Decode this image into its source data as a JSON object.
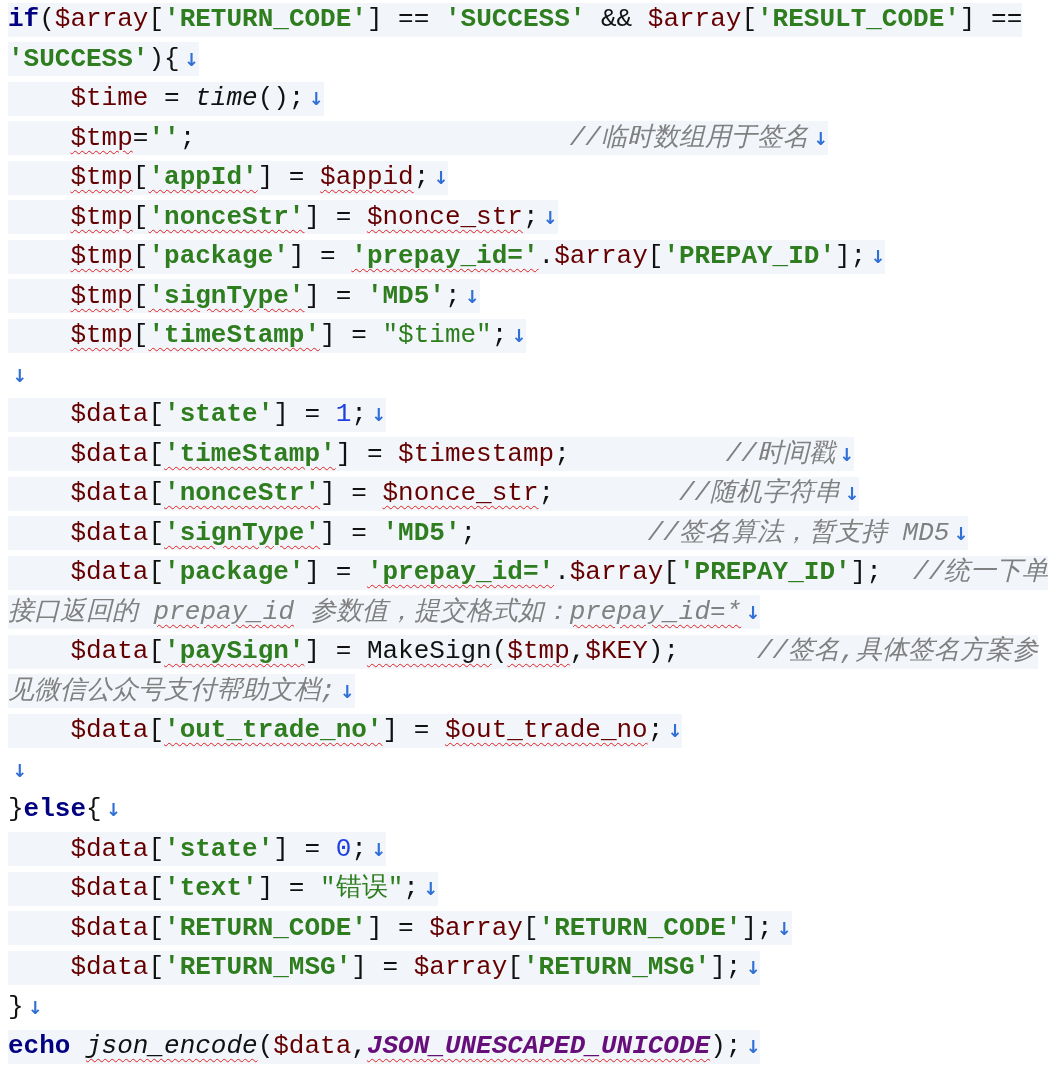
{
  "lines": [
    {
      "indented": false,
      "highlighted": true,
      "tokens": [
        {
          "kind": "keyword",
          "text": "if",
          "misspelled": false
        },
        {
          "kind": "plain",
          "text": "(",
          "misspelled": false
        },
        {
          "kind": "variable",
          "text": "$array",
          "misspelled": false
        },
        {
          "kind": "plain",
          "text": "[",
          "misspelled": false
        },
        {
          "kind": "string",
          "text": "'RETURN_CODE'",
          "misspelled": false
        },
        {
          "kind": "plain",
          "text": "] == ",
          "misspelled": false
        },
        {
          "kind": "string",
          "text": "'SUCCESS'",
          "misspelled": false
        },
        {
          "kind": "plain",
          "text": " && ",
          "misspelled": false
        },
        {
          "kind": "variable",
          "text": "$array",
          "misspelled": false
        },
        {
          "kind": "plain",
          "text": "[",
          "misspelled": false
        },
        {
          "kind": "string",
          "text": "'RESULT_CODE'",
          "misspelled": false
        },
        {
          "kind": "plain",
          "text": "] ==",
          "misspelled": false
        }
      ]
    },
    {
      "indented": false,
      "highlighted": true,
      "end_mark": "↓",
      "tokens": [
        {
          "kind": "string",
          "text": "'SUCCESS'",
          "misspelled": false
        },
        {
          "kind": "plain",
          "text": "){",
          "misspelled": false
        }
      ]
    },
    {
      "indented": true,
      "highlighted": true,
      "end_mark": "↓",
      "tokens": [
        {
          "kind": "variable",
          "text": "$time",
          "misspelled": false
        },
        {
          "kind": "plain",
          "text": " = ",
          "misspelled": false
        },
        {
          "kind": "function",
          "text": "time",
          "misspelled": false
        },
        {
          "kind": "plain",
          "text": "();",
          "misspelled": false
        }
      ]
    },
    {
      "indented": true,
      "highlighted": true,
      "end_mark": "↓",
      "tokens": [
        {
          "kind": "variable",
          "text": "$tmp",
          "misspelled": true
        },
        {
          "kind": "plain",
          "text": "=",
          "misspelled": false
        },
        {
          "kind": "string",
          "text": "''",
          "misspelled": false
        },
        {
          "kind": "plain",
          "text": ";                        ",
          "misspelled": false
        },
        {
          "kind": "comment",
          "text": "//临时数组用于签名",
          "misspelled": false
        }
      ]
    },
    {
      "indented": true,
      "highlighted": true,
      "end_mark": "↓",
      "tokens": [
        {
          "kind": "variable",
          "text": "$tmp",
          "misspelled": true
        },
        {
          "kind": "plain",
          "text": "[",
          "misspelled": false
        },
        {
          "kind": "string",
          "text": "'appId'",
          "misspelled": true
        },
        {
          "kind": "plain",
          "text": "] = ",
          "misspelled": false
        },
        {
          "kind": "variable",
          "text": "$appid",
          "misspelled": true
        },
        {
          "kind": "plain",
          "text": ";",
          "misspelled": false
        }
      ]
    },
    {
      "indented": true,
      "highlighted": true,
      "end_mark": "↓",
      "tokens": [
        {
          "kind": "variable",
          "text": "$tmp",
          "misspelled": true
        },
        {
          "kind": "plain",
          "text": "[",
          "misspelled": false
        },
        {
          "kind": "string",
          "text": "'nonceStr'",
          "misspelled": true
        },
        {
          "kind": "plain",
          "text": "] = ",
          "misspelled": false
        },
        {
          "kind": "variable",
          "text": "$nonce_str",
          "misspelled": true
        },
        {
          "kind": "plain",
          "text": ";",
          "misspelled": false
        }
      ]
    },
    {
      "indented": true,
      "highlighted": true,
      "end_mark": "↓",
      "tokens": [
        {
          "kind": "variable",
          "text": "$tmp",
          "misspelled": true
        },
        {
          "kind": "plain",
          "text": "[",
          "misspelled": false
        },
        {
          "kind": "string",
          "text": "'package'",
          "misspelled": false
        },
        {
          "kind": "plain",
          "text": "] = ",
          "misspelled": false
        },
        {
          "kind": "string",
          "text": "'prepay_id='",
          "misspelled": true
        },
        {
          "kind": "plain",
          "text": ".",
          "misspelled": false
        },
        {
          "kind": "variable",
          "text": "$array",
          "misspelled": false
        },
        {
          "kind": "plain",
          "text": "[",
          "misspelled": false
        },
        {
          "kind": "string",
          "text": "'PREPAY_ID'",
          "misspelled": false
        },
        {
          "kind": "plain",
          "text": "];",
          "misspelled": false
        }
      ]
    },
    {
      "indented": true,
      "highlighted": true,
      "end_mark": "↓",
      "tokens": [
        {
          "kind": "variable",
          "text": "$tmp",
          "misspelled": true
        },
        {
          "kind": "plain",
          "text": "[",
          "misspelled": false
        },
        {
          "kind": "string",
          "text": "'signType'",
          "misspelled": true
        },
        {
          "kind": "plain",
          "text": "] = ",
          "misspelled": false
        },
        {
          "kind": "string",
          "text": "'MD5'",
          "misspelled": false
        },
        {
          "kind": "plain",
          "text": ";",
          "misspelled": false
        }
      ]
    },
    {
      "indented": true,
      "highlighted": true,
      "end_mark": "↓",
      "tokens": [
        {
          "kind": "variable",
          "text": "$tmp",
          "misspelled": true
        },
        {
          "kind": "plain",
          "text": "[",
          "misspelled": false
        },
        {
          "kind": "string",
          "text": "'timeStamp'",
          "misspelled": true
        },
        {
          "kind": "plain",
          "text": "] = ",
          "misspelled": false
        },
        {
          "kind": "quoted",
          "text": "\"$time\"",
          "misspelled": false
        },
        {
          "kind": "plain",
          "text": ";",
          "misspelled": false
        }
      ]
    },
    {
      "indented": false,
      "highlighted": false,
      "end_mark": "↓"
    },
    {
      "indented": true,
      "highlighted": true,
      "end_mark": "↓",
      "tokens": [
        {
          "kind": "variable",
          "text": "$data",
          "misspelled": false
        },
        {
          "kind": "plain",
          "text": "[",
          "misspelled": false
        },
        {
          "kind": "string",
          "text": "'state'",
          "misspelled": false
        },
        {
          "kind": "plain",
          "text": "] = ",
          "misspelled": false
        },
        {
          "kind": "number",
          "text": "1",
          "misspelled": false
        },
        {
          "kind": "plain",
          "text": ";",
          "misspelled": false
        }
      ]
    },
    {
      "indented": true,
      "highlighted": true,
      "end_mark": "↓",
      "tokens": [
        {
          "kind": "variable",
          "text": "$data",
          "misspelled": false
        },
        {
          "kind": "plain",
          "text": "[",
          "misspelled": false
        },
        {
          "kind": "string",
          "text": "'timeStamp'",
          "misspelled": true
        },
        {
          "kind": "plain",
          "text": "] = ",
          "misspelled": false
        },
        {
          "kind": "variable",
          "text": "$timestamp",
          "misspelled": false
        },
        {
          "kind": "plain",
          "text": ";          ",
          "misspelled": false
        },
        {
          "kind": "comment",
          "text": "//时间戳",
          "misspelled": false
        }
      ]
    },
    {
      "indented": true,
      "highlighted": true,
      "end_mark": "↓",
      "tokens": [
        {
          "kind": "variable",
          "text": "$data",
          "misspelled": false
        },
        {
          "kind": "plain",
          "text": "[",
          "misspelled": false
        },
        {
          "kind": "string",
          "text": "'nonceStr'",
          "misspelled": true
        },
        {
          "kind": "plain",
          "text": "] = ",
          "misspelled": false
        },
        {
          "kind": "variable",
          "text": "$nonce_str",
          "misspelled": true
        },
        {
          "kind": "plain",
          "text": ";        ",
          "misspelled": false
        },
        {
          "kind": "comment",
          "text": "//随机字符串",
          "misspelled": false
        }
      ]
    },
    {
      "indented": true,
      "highlighted": true,
      "end_mark": "↓",
      "tokens": [
        {
          "kind": "variable",
          "text": "$data",
          "misspelled": false
        },
        {
          "kind": "plain",
          "text": "[",
          "misspelled": false
        },
        {
          "kind": "string",
          "text": "'signType'",
          "misspelled": true
        },
        {
          "kind": "plain",
          "text": "] = ",
          "misspelled": false
        },
        {
          "kind": "string",
          "text": "'MD5'",
          "misspelled": false
        },
        {
          "kind": "plain",
          "text": ";           ",
          "misspelled": false
        },
        {
          "kind": "comment",
          "text": "//签名算法，暂支持 MD5",
          "misspelled": false
        }
      ]
    },
    {
      "indented": true,
      "highlighted": true,
      "tokens": [
        {
          "kind": "variable",
          "text": "$data",
          "misspelled": false
        },
        {
          "kind": "plain",
          "text": "[",
          "misspelled": false
        },
        {
          "kind": "string",
          "text": "'package'",
          "misspelled": false
        },
        {
          "kind": "plain",
          "text": "] = ",
          "misspelled": false
        },
        {
          "kind": "string",
          "text": "'prepay_id='",
          "misspelled": true
        },
        {
          "kind": "plain",
          "text": ".",
          "misspelled": false
        },
        {
          "kind": "variable",
          "text": "$array",
          "misspelled": false
        },
        {
          "kind": "plain",
          "text": "[",
          "misspelled": false
        },
        {
          "kind": "string",
          "text": "'PREPAY_ID'",
          "misspelled": false
        },
        {
          "kind": "plain",
          "text": "];  ",
          "misspelled": false
        },
        {
          "kind": "comment",
          "text": "//统一下单",
          "misspelled": false
        }
      ]
    },
    {
      "indented": false,
      "highlighted": true,
      "end_mark": "↓",
      "tokens": [
        {
          "kind": "comment",
          "text": "接口返回的 ",
          "misspelled": false
        },
        {
          "kind": "comment",
          "text": "prepay_id",
          "misspelled": true
        },
        {
          "kind": "comment",
          "text": " 参数值，提交格式如：",
          "misspelled": false
        },
        {
          "kind": "comment",
          "text": "prepay_id=*",
          "misspelled": true
        }
      ]
    },
    {
      "indented": true,
      "highlighted": true,
      "tokens": [
        {
          "kind": "variable",
          "text": "$data",
          "misspelled": false
        },
        {
          "kind": "plain",
          "text": "[",
          "misspelled": false
        },
        {
          "kind": "string",
          "text": "'paySign'",
          "misspelled": true
        },
        {
          "kind": "plain",
          "text": "] = ",
          "misspelled": false
        },
        {
          "kind": "plain",
          "text": "MakeSign",
          "misspelled": true
        },
        {
          "kind": "plain",
          "text": "(",
          "misspelled": false
        },
        {
          "kind": "variable",
          "text": "$tmp",
          "misspelled": true
        },
        {
          "kind": "plain",
          "text": ",",
          "misspelled": false
        },
        {
          "kind": "variable",
          "text": "$KEY",
          "misspelled": false
        },
        {
          "kind": "plain",
          "text": ");     ",
          "misspelled": false
        },
        {
          "kind": "comment",
          "text": "//签名,具体签名方案参",
          "misspelled": false
        }
      ]
    },
    {
      "indented": false,
      "highlighted": true,
      "end_mark": "↓",
      "tokens": [
        {
          "kind": "comment",
          "text": "见微信公众号支付帮助文档;",
          "misspelled": false
        }
      ]
    },
    {
      "indented": true,
      "highlighted": true,
      "end_mark": "↓",
      "tokens": [
        {
          "kind": "variable",
          "text": "$data",
          "misspelled": false
        },
        {
          "kind": "plain",
          "text": "[",
          "misspelled": false
        },
        {
          "kind": "string",
          "text": "'out_trade_no'",
          "misspelled": true
        },
        {
          "kind": "plain",
          "text": "] = ",
          "misspelled": false
        },
        {
          "kind": "variable",
          "text": "$out_trade_no",
          "misspelled": true
        },
        {
          "kind": "plain",
          "text": ";",
          "misspelled": false
        }
      ]
    },
    {
      "indented": false,
      "highlighted": false,
      "end_mark": "↓"
    },
    {
      "indented": false,
      "highlighted": false,
      "end_mark": "↓",
      "tokens": [
        {
          "kind": "plain",
          "text": "}",
          "misspelled": false
        },
        {
          "kind": "keyword",
          "text": "else",
          "misspelled": false
        },
        {
          "kind": "plain",
          "text": "{",
          "misspelled": false
        }
      ]
    },
    {
      "indented": true,
      "highlighted": true,
      "end_mark": "↓",
      "tokens": [
        {
          "kind": "variable",
          "text": "$data",
          "misspelled": false
        },
        {
          "kind": "plain",
          "text": "[",
          "misspelled": false
        },
        {
          "kind": "string",
          "text": "'state'",
          "misspelled": false
        },
        {
          "kind": "plain",
          "text": "] = ",
          "misspelled": false
        },
        {
          "kind": "number",
          "text": "0",
          "misspelled": false
        },
        {
          "kind": "plain",
          "text": ";",
          "misspelled": false
        }
      ]
    },
    {
      "indented": true,
      "highlighted": true,
      "end_mark": "↓",
      "tokens": [
        {
          "kind": "variable",
          "text": "$data",
          "misspelled": false
        },
        {
          "kind": "plain",
          "text": "[",
          "misspelled": false
        },
        {
          "kind": "string",
          "text": "'text'",
          "misspelled": false
        },
        {
          "kind": "plain",
          "text": "] = ",
          "misspelled": false
        },
        {
          "kind": "quoted",
          "text": "\"错误\"",
          "misspelled": false
        },
        {
          "kind": "plain",
          "text": ";",
          "misspelled": false
        }
      ]
    },
    {
      "indented": true,
      "highlighted": true,
      "end_mark": "↓",
      "tokens": [
        {
          "kind": "variable",
          "text": "$data",
          "misspelled": false
        },
        {
          "kind": "plain",
          "text": "[",
          "misspelled": false
        },
        {
          "kind": "string",
          "text": "'RETURN_CODE'",
          "misspelled": false
        },
        {
          "kind": "plain",
          "text": "] = ",
          "misspelled": false
        },
        {
          "kind": "variable",
          "text": "$array",
          "misspelled": false
        },
        {
          "kind": "plain",
          "text": "[",
          "misspelled": false
        },
        {
          "kind": "string",
          "text": "'RETURN_CODE'",
          "misspelled": false
        },
        {
          "kind": "plain",
          "text": "];",
          "misspelled": false
        }
      ]
    },
    {
      "indented": true,
      "highlighted": true,
      "end_mark": "↓",
      "tokens": [
        {
          "kind": "variable",
          "text": "$data",
          "misspelled": false
        },
        {
          "kind": "plain",
          "text": "[",
          "misspelled": false
        },
        {
          "kind": "string",
          "text": "'RETURN_MSG'",
          "misspelled": false
        },
        {
          "kind": "plain",
          "text": "] = ",
          "misspelled": false
        },
        {
          "kind": "variable",
          "text": "$array",
          "misspelled": false
        },
        {
          "kind": "plain",
          "text": "[",
          "misspelled": false
        },
        {
          "kind": "string",
          "text": "'RETURN_MSG'",
          "misspelled": false
        },
        {
          "kind": "plain",
          "text": "];",
          "misspelled": false
        }
      ]
    },
    {
      "indented": false,
      "highlighted": false,
      "end_mark": "↓",
      "tokens": [
        {
          "kind": "plain",
          "text": "}",
          "misspelled": false
        }
      ]
    },
    {
      "indented": false,
      "highlighted": true,
      "end_mark": "↓",
      "tokens": [
        {
          "kind": "keyword",
          "text": "echo ",
          "misspelled": false
        },
        {
          "kind": "function",
          "text": "json_encode",
          "misspelled": true
        },
        {
          "kind": "plain",
          "text": "(",
          "misspelled": false
        },
        {
          "kind": "variable",
          "text": "$data",
          "misspelled": false
        },
        {
          "kind": "plain",
          "text": ",",
          "misspelled": false
        },
        {
          "kind": "constant",
          "text": "JSON_UNESCAPED_UNICODE",
          "misspelled": true
        },
        {
          "kind": "plain",
          "text": ");",
          "misspelled": false
        }
      ]
    }
  ]
}
